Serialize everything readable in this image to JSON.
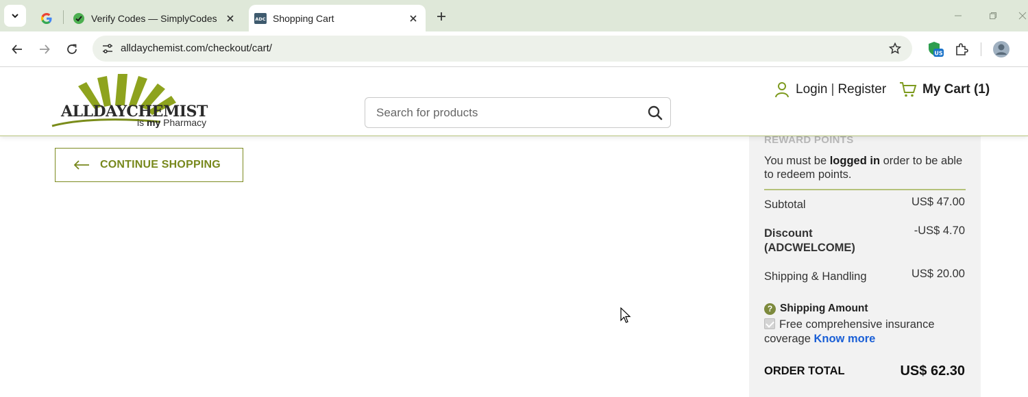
{
  "browser": {
    "tabs": [
      {
        "title": "",
        "icon": "google-icon"
      },
      {
        "title": "Verify Codes — SimplyCodes",
        "icon": "simplycodes-icon",
        "active": false
      },
      {
        "title": "Shopping Cart",
        "icon": "adc-icon",
        "active": true,
        "favicon_text": "ADC"
      }
    ],
    "url": "alldaychemist.com/checkout/cart/",
    "extension_badge": "US"
  },
  "header": {
    "logo_wordmark": "ALLDAYCHEMIST",
    "logo_tagline_pre": "is ",
    "logo_tagline_bold": "my",
    "logo_tagline_post": " Pharmacy",
    "search_placeholder": "Search for products",
    "login_label": "Login",
    "separator": "|",
    "register_label": "Register",
    "cart_label": "My Cart (1)"
  },
  "main": {
    "continue_label": "CONTINUE SHOPPING"
  },
  "summary": {
    "reward_title": "REWARD POINTS",
    "reward_pre": "You must be ",
    "reward_link": "logged in",
    "reward_post": " order to be able to redeem points.",
    "subtotal_label": "Subtotal",
    "subtotal_value": "US$ 47.00",
    "discount_label": "Discount (ADCWELCOME)",
    "discount_value": "-US$ 4.70",
    "shipping_label": "Shipping & Handling",
    "shipping_value": "US$ 20.00",
    "shipping_amount_label": "Shipping Amount",
    "insurance_text": "Free comprehensive insurance coverage",
    "know_more": "Know more",
    "insurance_checked": true,
    "order_total_label": "ORDER TOTAL",
    "order_total_value": "US$ 62.30"
  },
  "colors": {
    "brand_green": "#77881c",
    "tab_bar": "#dfe8d9",
    "link_blue": "#1a5fd6"
  }
}
